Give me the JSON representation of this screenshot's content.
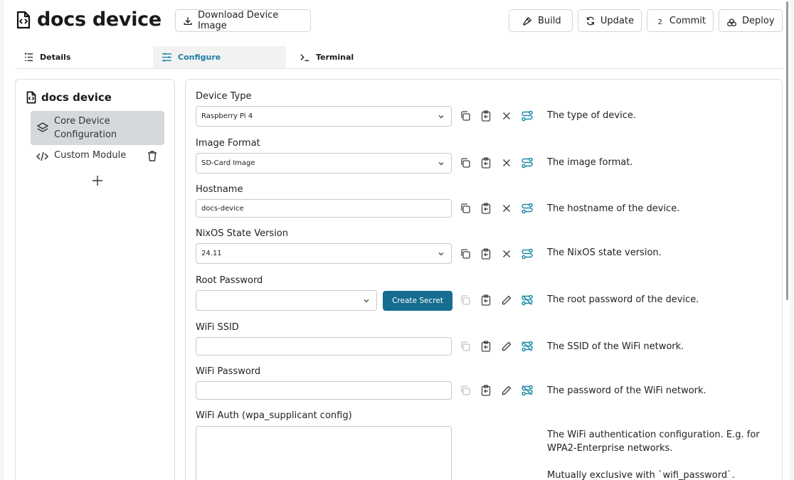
{
  "header": {
    "title": "docs device",
    "download_label": "Download Device Image",
    "build_label": "Build",
    "update_label": "Update",
    "commit_label": "Commit",
    "commit_count": "2",
    "deploy_label": "Deploy"
  },
  "tabs": [
    {
      "label": "Details",
      "icon": "list-icon"
    },
    {
      "label": "Configure",
      "icon": "sliders-icon",
      "active": true
    },
    {
      "label": "Terminal",
      "icon": "terminal-icon"
    }
  ],
  "sidebar": {
    "title": "docs device",
    "items": [
      {
        "label": "Core Device Configuration",
        "icon": "layers-icon",
        "active": true
      },
      {
        "label": "Custom Module",
        "icon": "code-icon"
      }
    ]
  },
  "fields": [
    {
      "label": "Device Type",
      "value": "Raspberry Pi 4",
      "kind": "select",
      "description": "The type of device."
    },
    {
      "label": "Image Format",
      "value": "SD-Card Image",
      "kind": "select",
      "description": "The image format."
    },
    {
      "label": "Hostname",
      "value": "docs-device",
      "kind": "text",
      "description": "The hostname of the device."
    },
    {
      "label": "NixOS State Version",
      "value": "24.11",
      "kind": "select",
      "description": "The NixOS state version."
    },
    {
      "label": "Root Password",
      "value": "",
      "kind": "secret-select",
      "button": "Create Secret",
      "description": "The root password of the device."
    },
    {
      "label": "WiFi SSID",
      "value": "",
      "kind": "secret",
      "description": "The SSID of the WiFi network."
    },
    {
      "label": "WiFi Password",
      "value": "",
      "kind": "secret",
      "description": "The password of the WiFi network."
    },
    {
      "label": "WiFi Auth (wpa_supplicant config)",
      "value": "",
      "kind": "textarea",
      "description": "The WiFi authentication configuration. E.g. for WPA2-Enterprise networks.",
      "description_2": "Mutually exclusive with `wifi_password`."
    }
  ],
  "colors": {
    "accent": "#1d7ea3",
    "primary_button": "#156d8f",
    "icon_teal": "#1a8aa8"
  }
}
